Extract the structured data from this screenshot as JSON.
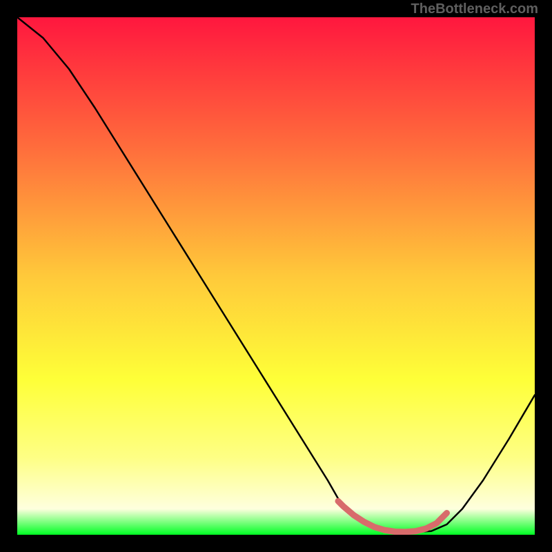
{
  "watermark": "TheBottleneck.com",
  "chart_data": {
    "type": "line",
    "title": "",
    "xlabel": "",
    "ylabel": "",
    "xlim": [
      0,
      100
    ],
    "ylim": [
      0,
      100
    ],
    "gradient_stops": [
      {
        "offset": 0,
        "color": "#ff173e"
      },
      {
        "offset": 25,
        "color": "#ff6c3c"
      },
      {
        "offset": 50,
        "color": "#ffc93a"
      },
      {
        "offset": 70,
        "color": "#feff38"
      },
      {
        "offset": 85,
        "color": "#feff84"
      },
      {
        "offset": 95,
        "color": "#feffde"
      },
      {
        "offset": 100,
        "color": "#00ff24"
      }
    ],
    "series": [
      {
        "name": "bottleneck-curve",
        "color": "#000000",
        "x": [
          0,
          5,
          10,
          15,
          20,
          25,
          30,
          35,
          40,
          45,
          50,
          55,
          60,
          62,
          65,
          68,
          72,
          76,
          80,
          83,
          86,
          90,
          95,
          100
        ],
        "y": [
          100,
          96,
          90,
          82.5,
          74.5,
          66.5,
          58.5,
          50.5,
          42.5,
          34.5,
          26.5,
          18.5,
          10.5,
          7,
          4,
          2,
          0.8,
          0.5,
          0.7,
          2,
          5,
          10.5,
          18.5,
          27
        ]
      },
      {
        "name": "optimal-zone",
        "color": "#d86b6b",
        "thick": true,
        "x": [
          62,
          63,
          65,
          67,
          69,
          71,
          73,
          75,
          77,
          79,
          81,
          82,
          83
        ],
        "y": [
          6.5,
          5.5,
          3.8,
          2.5,
          1.5,
          0.9,
          0.6,
          0.55,
          0.7,
          1.2,
          2.2,
          3.2,
          4.2
        ]
      }
    ]
  }
}
